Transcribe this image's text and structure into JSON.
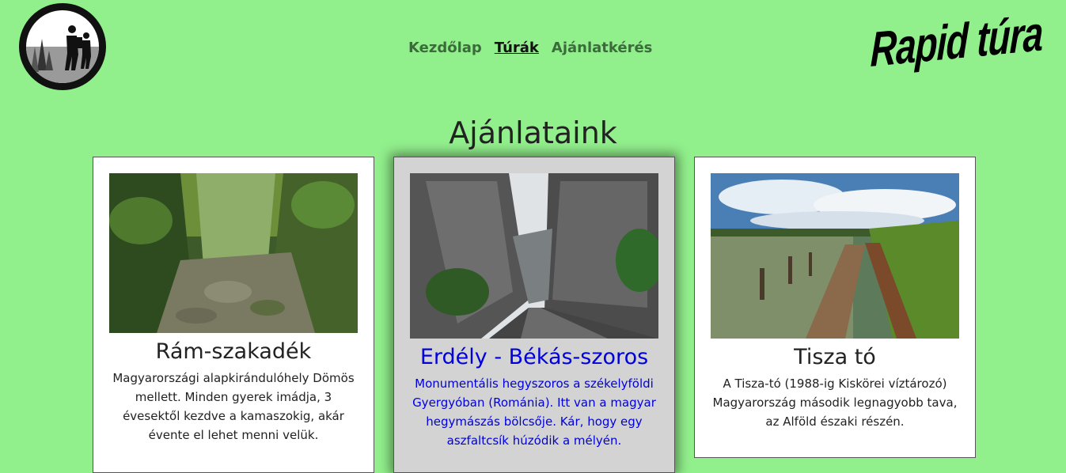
{
  "nav": {
    "items": [
      {
        "label": "Kezdőlap",
        "active": false
      },
      {
        "label": "Túrák",
        "active": true
      },
      {
        "label": "Ajánlatkérés",
        "active": false
      }
    ]
  },
  "brand": "Rapid túra",
  "page_title": "Ajánlataink",
  "cards": [
    {
      "title": "Rám-szakadék",
      "text": "Magyarországi alapkirándulóhely Dömös mellett. Minden gyerek imádja, 3 évesektől kezdve a kamaszokig, akár évente el lehet menni velük."
    },
    {
      "title": "Erdély - Békás-szoros",
      "text": "Monumentális hegyszoros a székelyföldi Gyergyóban (Románia). Itt van a magyar hegymászás bölcsője. Kár, hogy egy aszfaltcsík húzódik a mélyén."
    },
    {
      "title": "Tisza tó",
      "text": "A Tisza-tó (1988-ig Kiskörei víztározó) Magyarország második legnagyobb tava, az Alföld északi részén."
    }
  ],
  "colors": {
    "background": "#92f08c",
    "card_highlight_bg": "#d3d3d3",
    "card_highlight_text": "#0000dd"
  }
}
